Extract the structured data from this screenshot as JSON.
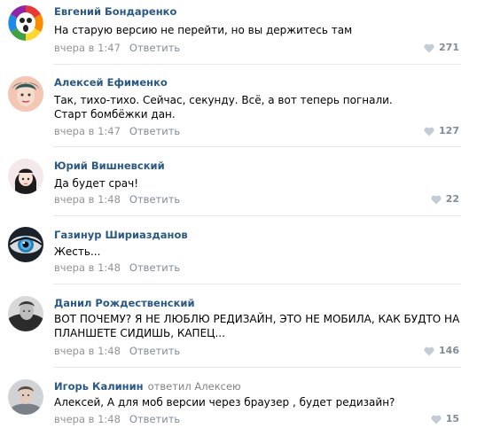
{
  "comments": [
    {
      "author": "Евгений Бондаренко",
      "reply_to": "",
      "text": "На старую версию не перейти, но вы держитесь там",
      "time": "вчера в 1:47",
      "reply_label": "Ответить",
      "likes": "271",
      "avatar": "rainbow-logo"
    },
    {
      "author": "Алексей Ефименко",
      "reply_to": "",
      "text": "Так, тихо-тихо. Сейчас, секунду. Всё, а вот теперь погнали. Старт бомбёжки дан.",
      "time": "вчера в 1:47",
      "reply_label": "Ответить",
      "likes": "127",
      "avatar": "pink-portrait"
    },
    {
      "author": "Юрий Вишневский",
      "reply_to": "",
      "text": "Да будет срач!",
      "time": "вчера в 1:48",
      "reply_label": "Ответить",
      "likes": "22",
      "avatar": "cartoon-girl"
    },
    {
      "author": "Газинур Шириазданов",
      "reply_to": "",
      "text": "Жесть...",
      "time": "вчера в 1:48",
      "reply_label": "Ответить",
      "likes": "",
      "avatar": "blue-eye"
    },
    {
      "author": "Данил Рождественский",
      "reply_to": "",
      "text": "ВОТ ПОЧЕМУ? Я НЕ ЛЮБЛЮ РЕДИЗАЙН, ЭТО НЕ МОБИЛА, КАК БУДТО НА ПЛАНШЕТЕ СИДИШЬ, КАПЕЦ...",
      "time": "вчера в 1:48",
      "reply_label": "Ответить",
      "likes": "146",
      "avatar": "bw-portrait"
    },
    {
      "author": "Игорь Калинин",
      "reply_to": "ответил Алексею",
      "text": "Алексей, А для моб версии через браузер , будет редизайн?",
      "time": "вчера в 1:48",
      "reply_label": "Ответить",
      "likes": "15",
      "avatar": "gray-portrait"
    }
  ],
  "colors": {
    "author": "#2a5885",
    "meta": "#939393",
    "likes": "#818c99",
    "divider": "#e7e8ec"
  },
  "icons": {
    "like": "heart-icon"
  }
}
